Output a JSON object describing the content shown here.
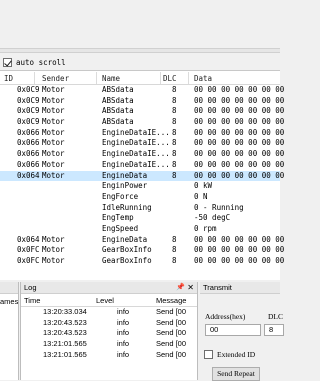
{
  "autoscroll": {
    "label": "auto scroll",
    "checked": true
  },
  "table": {
    "headers": {
      "id": "ID",
      "sender": "Sender",
      "name": "Name",
      "dlc": "DLC",
      "data": "Data"
    },
    "rows": [
      {
        "id": "0x0C9",
        "sender": "Motor",
        "name": "ABSdata",
        "dlc": "8",
        "data": "00 00 00 00 00 00 00"
      },
      {
        "id": "0x0C9",
        "sender": "Motor",
        "name": "ABSdata",
        "dlc": "8",
        "data": "00 00 00 00 00 00 00"
      },
      {
        "id": "0x0C9",
        "sender": "Motor",
        "name": "ABSdata",
        "dlc": "8",
        "data": "00 00 00 00 00 00 00"
      },
      {
        "id": "0x0C9",
        "sender": "Motor",
        "name": "ABSdata",
        "dlc": "8",
        "data": "00 00 00 00 00 00 00"
      },
      {
        "id": "0x066",
        "sender": "Motor",
        "name": "EngineDataIE...",
        "dlc": "8",
        "data": "00 00 00 00 00 00 00"
      },
      {
        "id": "0x066",
        "sender": "Motor",
        "name": "EngineDataIE...",
        "dlc": "8",
        "data": "00 00 00 00 00 00 00"
      },
      {
        "id": "0x066",
        "sender": "Motor",
        "name": "EngineDataIE...",
        "dlc": "8",
        "data": "00 00 00 00 00 00 00"
      },
      {
        "id": "0x066",
        "sender": "Motor",
        "name": "EngineDataIE...",
        "dlc": "8",
        "data": "00 00 00 00 00 00 00"
      },
      {
        "id": "0x064",
        "sender": "Motor",
        "name": "EngineData",
        "dlc": "8",
        "data": "00 00 00 00 00 00 00",
        "selected": true
      },
      {
        "id": "",
        "sender": "",
        "name": "EnginPower",
        "dlc": "",
        "data": "0 kW"
      },
      {
        "id": "",
        "sender": "",
        "name": "EngForce",
        "dlc": "",
        "data": "0 N"
      },
      {
        "id": "",
        "sender": "",
        "name": "IdleRunning",
        "dlc": "",
        "data": "0 - Running"
      },
      {
        "id": "",
        "sender": "",
        "name": "EngTemp",
        "dlc": "",
        "data": "-50 degC"
      },
      {
        "id": "",
        "sender": "",
        "name": "EngSpeed",
        "dlc": "",
        "data": "0 rpm"
      },
      {
        "id": "0x064",
        "sender": "Motor",
        "name": "EngineData",
        "dlc": "8",
        "data": "00 00 00 00 00 00 00"
      },
      {
        "id": "0x0FC",
        "sender": "Motor",
        "name": "GearBoxInfo",
        "dlc": "8",
        "data": "00 00 00 00 00 00 00"
      },
      {
        "id": "0x0FC",
        "sender": "Motor",
        "name": "GearBoxInfo",
        "dlc": "8",
        "data": "00 00 00 00 00 00 00"
      }
    ]
  },
  "left_panel": {
    "fragment": "ames"
  },
  "log": {
    "title": "Log",
    "pin_icon": "pin-icon",
    "close_icon": "close-icon",
    "headers": {
      "time": "Time",
      "level": "Level",
      "message": "Message"
    },
    "rows": [
      {
        "time": "13:20:33.034",
        "level": "info",
        "message": "Send [00"
      },
      {
        "time": "13:20:43.523",
        "level": "info",
        "message": "Send [00"
      },
      {
        "time": "13:20:43.523",
        "level": "info",
        "message": "Send [00"
      },
      {
        "time": "13:21:01.565",
        "level": "info",
        "message": "Send [00"
      },
      {
        "time": "13:21:01.565",
        "level": "info",
        "message": "Send [00"
      }
    ]
  },
  "transmit": {
    "title": "Transmit",
    "address_label": "Address(hex)",
    "dlc_label": "DLC",
    "address_value": "00",
    "dlc_value": "8",
    "extended_label": "Extended ID",
    "send_repeat_label": "Send Repeat"
  }
}
